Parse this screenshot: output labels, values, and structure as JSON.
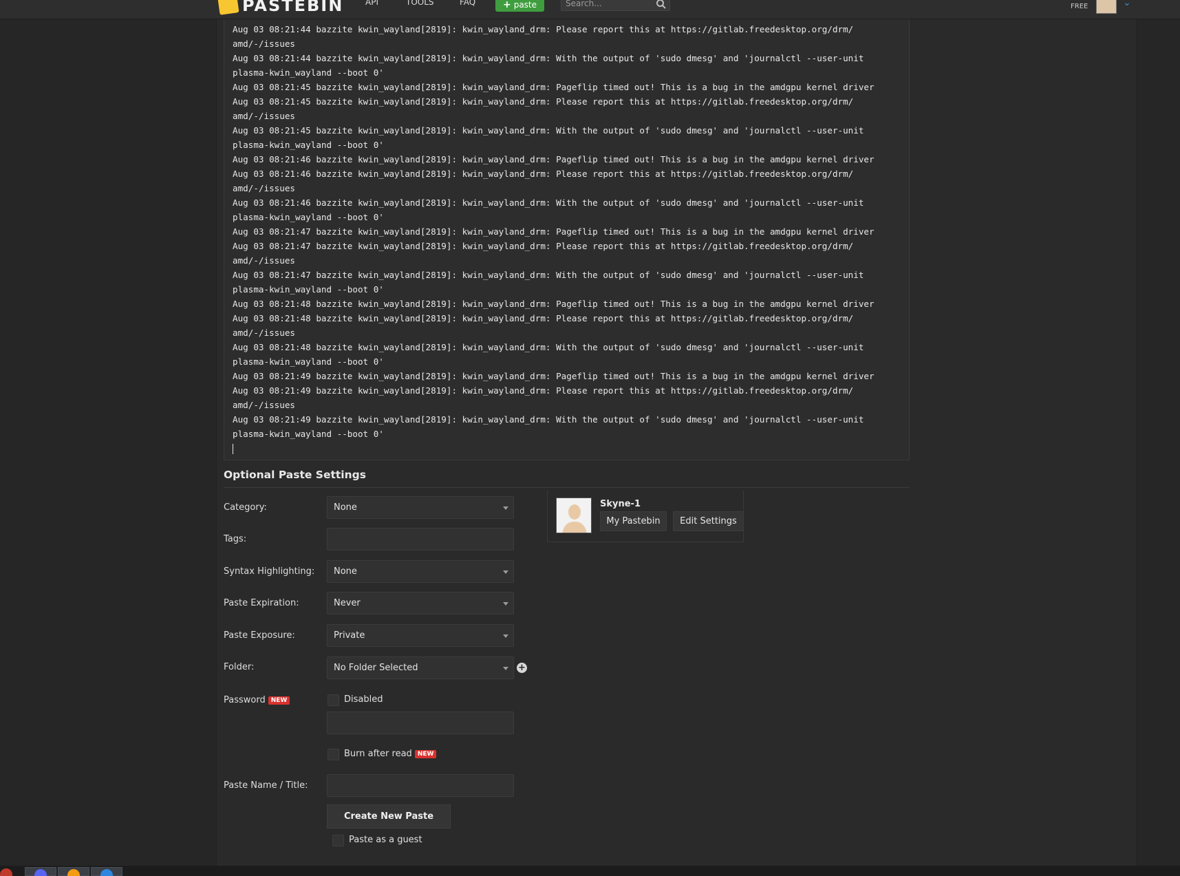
{
  "header": {
    "logo_text": "PASTEBIN",
    "nav": {
      "api": "API",
      "tools": "TOOLS",
      "faq": "FAQ"
    },
    "paste_button": "paste",
    "search_placeholder": "Search...",
    "account_plan": "FREE"
  },
  "editor": {
    "lines": [
      "Aug 03 08:21:44 bazzite kwin_wayland[2819]: kwin_wayland_drm: Please report this at https://gitlab.freedesktop.org/drm/",
      "amd/-/issues",
      "Aug 03 08:21:44 bazzite kwin_wayland[2819]: kwin_wayland_drm: With the output of 'sudo dmesg' and 'journalctl --user-unit",
      "plasma-kwin_wayland --boot 0'",
      "Aug 03 08:21:45 bazzite kwin_wayland[2819]: kwin_wayland_drm: Pageflip timed out! This is a bug in the amdgpu kernel driver",
      "Aug 03 08:21:45 bazzite kwin_wayland[2819]: kwin_wayland_drm: Please report this at https://gitlab.freedesktop.org/drm/",
      "amd/-/issues",
      "Aug 03 08:21:45 bazzite kwin_wayland[2819]: kwin_wayland_drm: With the output of 'sudo dmesg' and 'journalctl --user-unit",
      "plasma-kwin_wayland --boot 0'",
      "Aug 03 08:21:46 bazzite kwin_wayland[2819]: kwin_wayland_drm: Pageflip timed out! This is a bug in the amdgpu kernel driver",
      "Aug 03 08:21:46 bazzite kwin_wayland[2819]: kwin_wayland_drm: Please report this at https://gitlab.freedesktop.org/drm/",
      "amd/-/issues",
      "Aug 03 08:21:46 bazzite kwin_wayland[2819]: kwin_wayland_drm: With the output of 'sudo dmesg' and 'journalctl --user-unit",
      "plasma-kwin_wayland --boot 0'",
      "Aug 03 08:21:47 bazzite kwin_wayland[2819]: kwin_wayland_drm: Pageflip timed out! This is a bug in the amdgpu kernel driver",
      "Aug 03 08:21:47 bazzite kwin_wayland[2819]: kwin_wayland_drm: Please report this at https://gitlab.freedesktop.org/drm/",
      "amd/-/issues",
      "Aug 03 08:21:47 bazzite kwin_wayland[2819]: kwin_wayland_drm: With the output of 'sudo dmesg' and 'journalctl --user-unit",
      "plasma-kwin_wayland --boot 0'",
      "Aug 03 08:21:48 bazzite kwin_wayland[2819]: kwin_wayland_drm: Pageflip timed out! This is a bug in the amdgpu kernel driver",
      "Aug 03 08:21:48 bazzite kwin_wayland[2819]: kwin_wayland_drm: Please report this at https://gitlab.freedesktop.org/drm/",
      "amd/-/issues",
      "Aug 03 08:21:48 bazzite kwin_wayland[2819]: kwin_wayland_drm: With the output of 'sudo dmesg' and 'journalctl --user-unit",
      "plasma-kwin_wayland --boot 0'",
      "Aug 03 08:21:49 bazzite kwin_wayland[2819]: kwin_wayland_drm: Pageflip timed out! This is a bug in the amdgpu kernel driver",
      "Aug 03 08:21:49 bazzite kwin_wayland[2819]: kwin_wayland_drm: Please report this at https://gitlab.freedesktop.org/drm/",
      "amd/-/issues",
      "Aug 03 08:21:49 bazzite kwin_wayland[2819]: kwin_wayland_drm: With the output of 'sudo dmesg' and 'journalctl --user-unit",
      "plasma-kwin_wayland --boot 0'"
    ]
  },
  "settings": {
    "title": "Optional Paste Settings",
    "category": {
      "label": "Category:",
      "value": "None"
    },
    "tags": {
      "label": "Tags:",
      "value": ""
    },
    "syntax": {
      "label": "Syntax Highlighting:",
      "value": "None"
    },
    "expiration": {
      "label": "Paste Expiration:",
      "value": "Never"
    },
    "exposure": {
      "label": "Paste Exposure:",
      "value": "Private"
    },
    "folder": {
      "label": "Folder:",
      "value": "No Folder Selected"
    },
    "password": {
      "label": "Password",
      "badge": "NEW",
      "checkbox_label": "Disabled",
      "value": ""
    },
    "burn": {
      "label": "Burn after read",
      "badge": "NEW"
    },
    "title_field": {
      "label": "Paste Name / Title:",
      "value": ""
    },
    "create_button": "Create New Paste",
    "guest_label": "Paste as a guest"
  },
  "user": {
    "name": "Skyne-1",
    "my_pastebin": "My Pastebin",
    "edit_settings": "Edit Settings"
  },
  "colors": {
    "accent_green": "#3f9d3f",
    "badge_red": "#d9322f",
    "logo_yellow": "#f7c631",
    "background": "#262626"
  }
}
